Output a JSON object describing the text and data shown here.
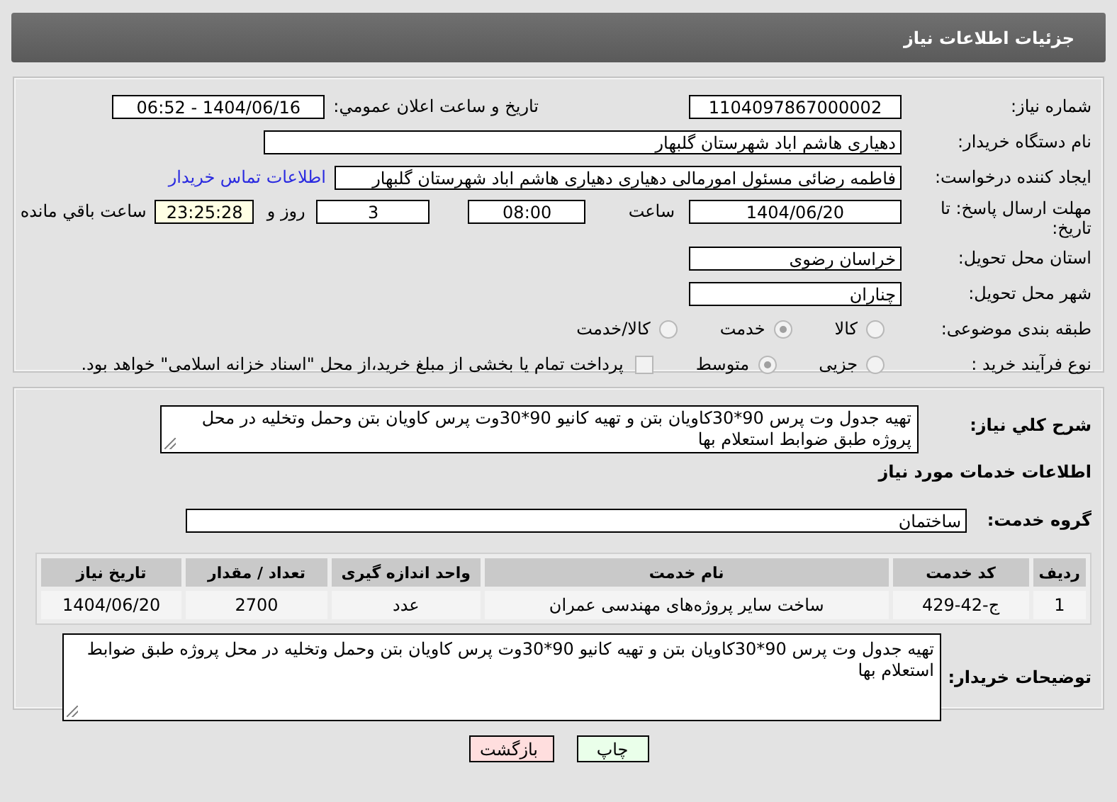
{
  "header": {
    "title": "جزئيات اطلاعات نياز"
  },
  "details": {
    "need_number": {
      "label": "شماره نياز:",
      "value": "1104097867000002"
    },
    "announce": {
      "label": "تاريخ و ساعت اعلان عمومي:",
      "value": "1404/06/16 - 06:52"
    },
    "buyer_org": {
      "label": "نام دستگاه خريدار:",
      "value": "دهياری هاشم اباد شهرستان گلبهار"
    },
    "creator": {
      "label": "ایجاد کننده درخواست:",
      "value": "فاطمه رضائی مسئول امورمالی دهیاری  دهیاری هاشم اباد شهرستان گلبهار",
      "link": "اطلاعات تماس خريدار"
    },
    "deadline": {
      "label": "مهلت ارسال پاسخ: تا تاریخ:",
      "date": "1404/06/20",
      "time_label": "ساعت",
      "time": "08:00",
      "days": "3",
      "days_label": "روز و",
      "remaining": "23:25:28",
      "remaining_label": "ساعت باقي مانده"
    },
    "province": {
      "label": "استان محل تحویل:",
      "value": "خراسان رضوی"
    },
    "city": {
      "label": "شهر محل تحویل:",
      "value": "چناران"
    },
    "category": {
      "label": "طبقه بندی موضوعی:",
      "options": [
        {
          "label": "کالا",
          "selected": false
        },
        {
          "label": "خدمت",
          "selected": true
        },
        {
          "label": "کالا/خدمت",
          "selected": false
        }
      ]
    },
    "process": {
      "label": "نوع فرآیند خرید :",
      "options": [
        {
          "label": "جزیی",
          "selected": false
        },
        {
          "label": "متوسط",
          "selected": true
        }
      ],
      "payment": {
        "checked": false,
        "text": "پرداخت تمام یا بخشی از مبلغ خرید،از محل \"اسناد خزانه اسلامی\" خواهد بود."
      }
    }
  },
  "services": {
    "summary": {
      "label": "شرح كلي نياز:",
      "value": "تهیه جدول وت پرس 90*30کاویان بتن و تهیه کانیو 90*30وت پرس کاویان بتن   وحمل وتخلیه در محل پروژه طبق ضوابط استعلام بها"
    },
    "section_title": "اطلاعات خدمات مورد نياز",
    "group": {
      "label": "گروه خدمت:",
      "value": "ساختمان"
    },
    "table": {
      "columns": [
        "ردیف",
        "کد خدمت",
        "نام خدمت",
        "واحد اندازه گیری",
        "تعداد / مقدار",
        "تاریخ نیاز"
      ],
      "rows": [
        [
          "1",
          "ج-42-429",
          "ساخت سایر پروژه‌های مهندسی عمران",
          "عدد",
          "2700",
          "1404/06/20"
        ]
      ]
    },
    "notes": {
      "label": "توضیحات خریدار:",
      "value": "تهیه جدول وت پرس 90*30کاویان بتن و تهیه کانیو 90*30وت پرس کاویان بتن   وحمل وتخلیه در محل پروژه طبق ضوابط استعلام بها"
    }
  },
  "buttons": [
    {
      "label": "چاپ",
      "kind": "print"
    },
    {
      "label": "بازگشت",
      "kind": "back"
    }
  ]
}
